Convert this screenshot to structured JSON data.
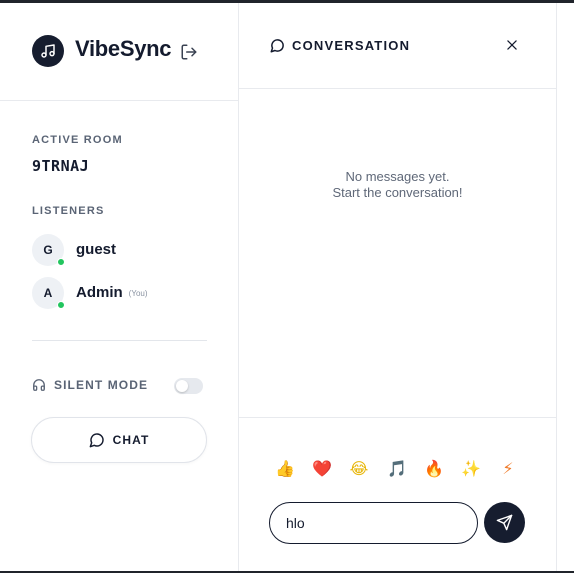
{
  "app": {
    "name": "VibeSync",
    "logo_icon": "music-note-icon",
    "logout_icon": "logout-icon"
  },
  "room": {
    "label": "ACTIVE ROOM",
    "code": "9TRNAJ"
  },
  "listeners": {
    "label": "LISTENERS",
    "items": [
      {
        "initial": "G",
        "name": "guest",
        "you": "",
        "online": true
      },
      {
        "initial": "A",
        "name": "Admin",
        "you": "(You)",
        "online": true
      }
    ]
  },
  "silent_mode": {
    "label": "SILENT MODE",
    "icon": "headphones-icon",
    "enabled": false
  },
  "chat_button": {
    "label": "CHAT",
    "icon": "chat-bubble-icon"
  },
  "conversation": {
    "title": "CONVERSATION",
    "empty_line1": "No messages yet.",
    "empty_line2": "Start the conversation!",
    "emojis": [
      "👍",
      "❤️",
      "😂",
      "🎵",
      "🔥",
      "✨",
      "⚡"
    ],
    "input_value": "hlo",
    "send_icon": "send-icon",
    "close_icon": "close-icon"
  },
  "colors": {
    "primary": "#161d2f",
    "online": "#22c55e",
    "muted": "#5a6475",
    "emoji_colors": [
      "#f5a623",
      "#e0245e",
      "#e8b70c",
      "#7c5cc4",
      "#f26b1d",
      "#f5b93a",
      "#f07b2a"
    ]
  }
}
